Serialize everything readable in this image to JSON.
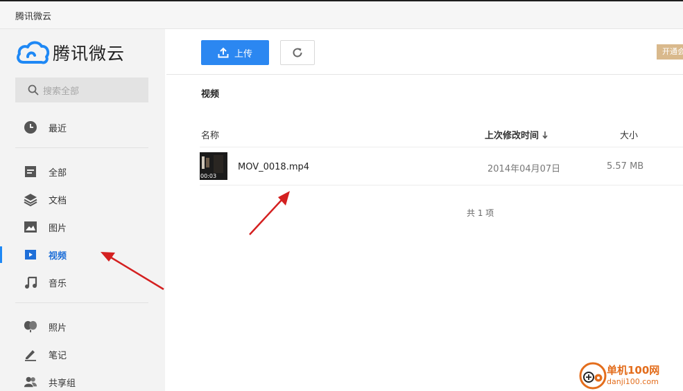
{
  "window": {
    "title": "腾讯微云"
  },
  "sidebar": {
    "logo_text": "腾讯微云",
    "search_placeholder": "搜索全部",
    "items": [
      {
        "label": "最近",
        "icon": "clock-icon"
      },
      {
        "label": "全部",
        "icon": "file-list-icon"
      },
      {
        "label": "文档",
        "icon": "layers-icon"
      },
      {
        "label": "图片",
        "icon": "image-icon"
      },
      {
        "label": "视频",
        "icon": "play-icon",
        "active": true
      },
      {
        "label": "音乐",
        "icon": "music-note-icon"
      },
      {
        "label": "照片",
        "icon": "photo-balloon-icon"
      },
      {
        "label": "笔记",
        "icon": "pencil-icon"
      },
      {
        "label": "共享组",
        "icon": "people-icon"
      }
    ]
  },
  "toolbar": {
    "upload_label": "上传",
    "upload_icon": "upload-icon",
    "refresh_icon": "refresh-icon",
    "vip_label": "开通会员"
  },
  "main": {
    "folder_title": "视频",
    "columns": {
      "name": "名称",
      "modified": "上次修改时间",
      "size": "大小"
    },
    "sort_icon": "arrow-down-icon",
    "files": [
      {
        "name": "MOV_0018.mp4",
        "modified": "2014年04月07日",
        "size": "5.57 MB",
        "duration": "00:03"
      }
    ],
    "total": "共 1 项"
  },
  "watermark": {
    "name": "单机100网",
    "url": "danji100.com"
  },
  "colors": {
    "accent": "#2b87f1",
    "active_text": "#1e6fd8",
    "sidebar_bg": "#f3f3f3",
    "vip": "#d9b98c",
    "annotation_arrow": "#d42020",
    "watermark": "#e36d1c"
  }
}
